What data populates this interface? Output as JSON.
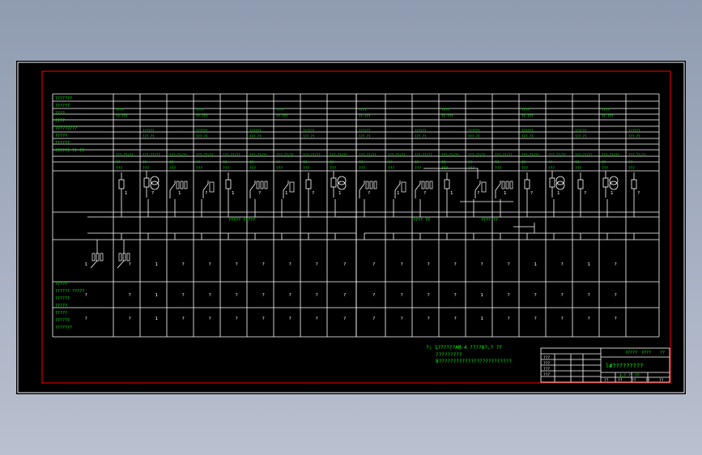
{
  "drawing": {
    "border_color": "#ffffff",
    "frame_color": "#ff0000",
    "line_color": "#ffffff",
    "text_color": "#00ff00",
    "background": "#000000"
  },
  "left_header_rows": [
    "???????",
    "??????",
    "????",
    "????",
    "?????????",
    "?????",
    "??????",
    "?????? ?? ??"
  ],
  "left_footer_rows": [
    "?????",
    "?????? ?????",
    "??????",
    "?????",
    "?????",
    "??????",
    "???????"
  ],
  "busbar_labels": {
    "left": "????? ?????",
    "right_a": "???? ??",
    "right_b": "???? ??"
  },
  "cabinet_count": 20,
  "middle_row_values": [
    "1",
    "?",
    "1",
    "?",
    "?",
    "?",
    "?",
    "?",
    "?",
    "?",
    "?",
    "?",
    "?",
    "?",
    "?",
    "?",
    "1",
    "?",
    "1",
    "?"
  ],
  "lower_row_values": [
    "?",
    "?",
    "1",
    "?",
    "?",
    "?",
    "?",
    "?",
    "?",
    "?",
    "?",
    "?",
    "?",
    "?",
    "1",
    "?",
    "?",
    "?",
    "?",
    "?"
  ],
  "notes": {
    "line1": "?: 1??????AM-4    ????8?.?    ??",
    "line2": "?????????",
    "line3": "8?????????????????????????"
  },
  "title_block": {
    "drawing_title": "l#?????????",
    "header_cells": [
      "?????",
      "????",
      "??"
    ],
    "left_rows": [
      "???",
      "???",
      "???",
      "???"
    ],
    "bottom_cells": [
      "??",
      "??",
      "??",
      "??",
      "??"
    ],
    "scale_text": "1:? ?? ??"
  }
}
